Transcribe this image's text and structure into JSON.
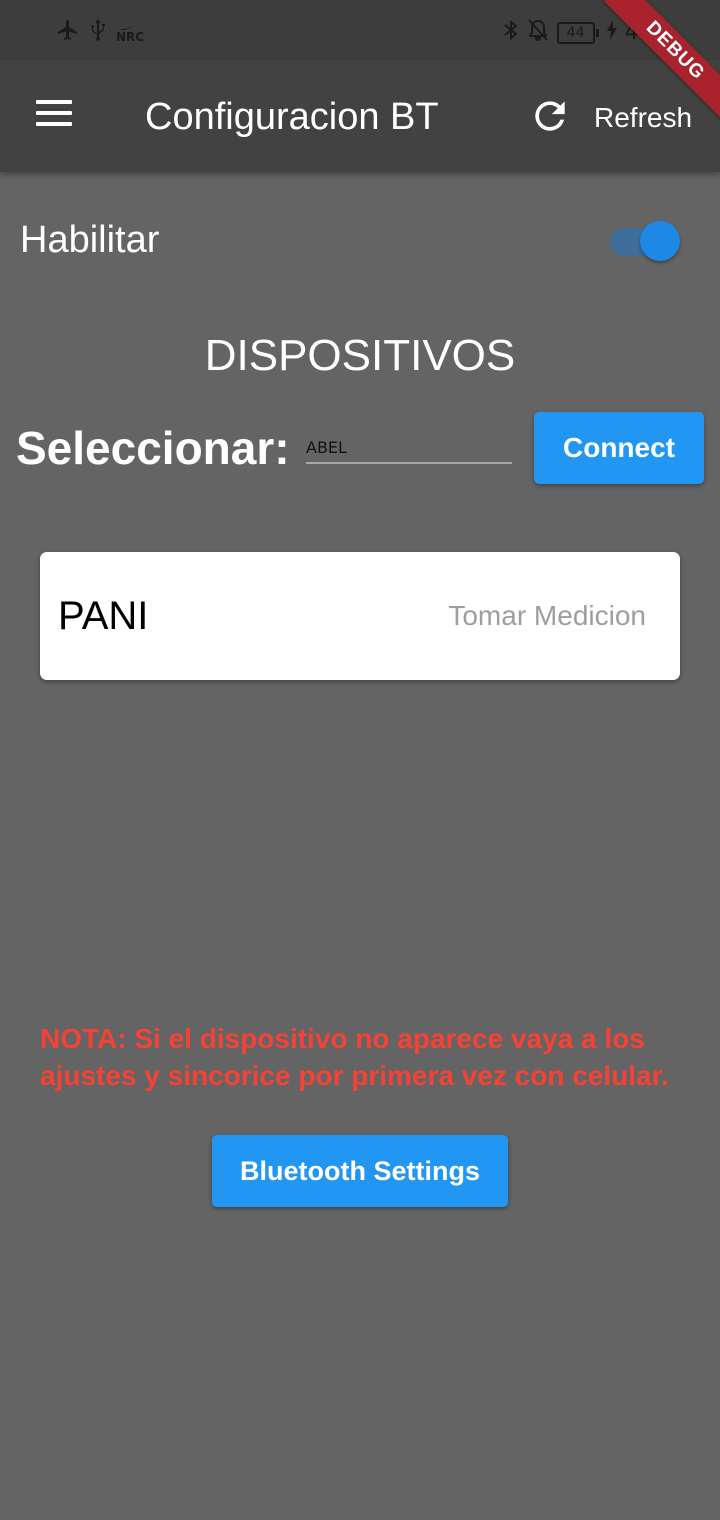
{
  "status_bar": {
    "left_icons": [
      "airplane-icon",
      "usb-icon",
      "nike-nrc-icon"
    ],
    "nrc_text": "NRC",
    "right_icons": [
      "bluetooth-icon",
      "mute-icon",
      "battery-icon",
      "charging-icon"
    ],
    "battery_level": "44",
    "time": "4:0"
  },
  "debug_banner": "DEBUG",
  "app_bar": {
    "menu_icon": "menu-icon",
    "title": "Configuracion BT",
    "refresh_icon": "refresh-icon",
    "refresh_label": "Refresh"
  },
  "enable": {
    "label": "Habilitar",
    "toggle_on": true
  },
  "devices": {
    "section_title": "DISPOSITIVOS",
    "select_label": "Seleccionar:",
    "selected_device": "ABEL",
    "connect_label": "Connect"
  },
  "device_card": {
    "name": "PANI",
    "action_label": "Tomar Medicion"
  },
  "note": "NOTA: Si el dispositivo no aparece vaya a los ajustes y sincorice por primera vez con celular.",
  "bluetooth_settings_label": "Bluetooth Settings",
  "colors": {
    "background": "#646464",
    "app_bar": "#424242",
    "accent": "#2196f3",
    "warning": "#f44336"
  }
}
